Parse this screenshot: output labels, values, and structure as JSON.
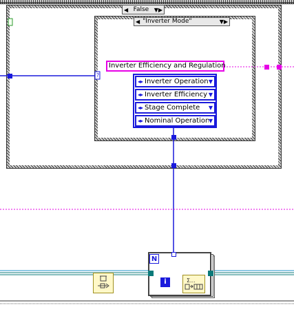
{
  "case_structure_outer": {
    "selector_label": "False"
  },
  "case_structure_inner": {
    "selector_label": "\"Inverter Mode\""
  },
  "string_constant": {
    "value": "Inverter Efficiency and Regulation"
  },
  "enum_constants": [
    {
      "label": "Inverter Operation"
    },
    {
      "label": "Inverter Efficiency"
    },
    {
      "label": "Stage Complete"
    },
    {
      "label": "Nominal Operation"
    }
  ],
  "for_loop": {
    "count_terminal": "N",
    "iteration_terminal": "i",
    "unknown_tunnel": "?"
  },
  "colors": {
    "enum_wire": "#1a1adc",
    "string_wire": "#e600e6",
    "error_wire": "#0a7a7a",
    "refnum_wire": "#1e90c8"
  },
  "icons": [
    "arrow-up-down-icon",
    "dropdown-arrow-icon",
    "delete-queue-node-icon",
    "queue-loop-node-icon"
  ]
}
